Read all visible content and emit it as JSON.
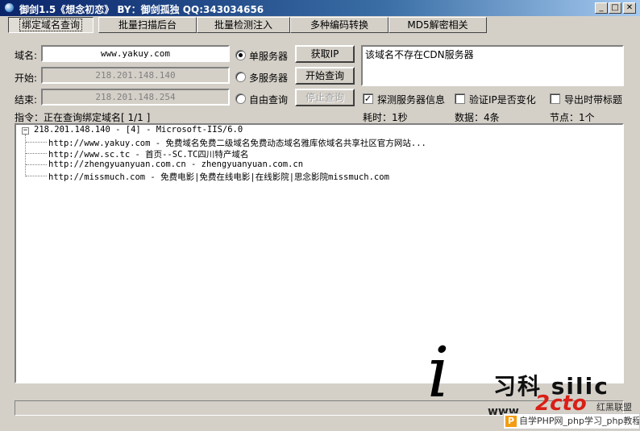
{
  "window": {
    "title": "御剑1.5《想念初恋》  BY：御剑孤独 QQ:343034656"
  },
  "tabs": [
    "绑定域名查询",
    "批量扫描后台",
    "批量检测注入",
    "多种编码转换",
    "MD5解密相关"
  ],
  "form": {
    "domain_label": "域名:",
    "domain_value": "www.yakuy.com",
    "start_label": "开始:",
    "start_value": "218.201.148.140",
    "end_label": "结束:",
    "end_value": "218.201.148.254",
    "radios": [
      {
        "label": "单服务器",
        "checked": true
      },
      {
        "label": "多服务器",
        "checked": false
      },
      {
        "label": "自由查询",
        "checked": false
      }
    ],
    "buttons": {
      "get_ip": "获取IP",
      "start_query": "开始查询",
      "stop_query": "停止查询"
    },
    "cdn_message": "该域名不存在CDN服务器",
    "checkboxes": [
      {
        "label": "探测服务器信息",
        "checked": true
      },
      {
        "label": "验证IP是否变化",
        "checked": false
      },
      {
        "label": "导出时带标题",
        "checked": false
      }
    ]
  },
  "status": {
    "command": "指令：正在查询绑定域名[ 1/1 ]",
    "time": "耗时：1秒",
    "data": "数据：4条",
    "nodes": "节点：1个"
  },
  "tree": {
    "root": "218.201.148.140 - [4] - Microsoft-IIS/6.0",
    "items": [
      "http://www.yakuy.com - 免费域名免费二级域名免费动态域名雅库依域名共享社区官方网站...",
      "http://www.sc.tc - 首页--SC.TC四川特产域名",
      "http://zhengyuanyuan.com.cn - zhengyuanyuan.com.cn",
      "http://missmuch.com - 免费电影|免费在线电影|在线影院|思念影院missmuch.com"
    ]
  },
  "watermark": {
    "big": "i",
    "sub": "习科 silic",
    "brand": "2cto",
    "www": "www",
    "cn": "红黑联盟",
    "php_bar": "自学PHP网_php学习_php教程"
  }
}
